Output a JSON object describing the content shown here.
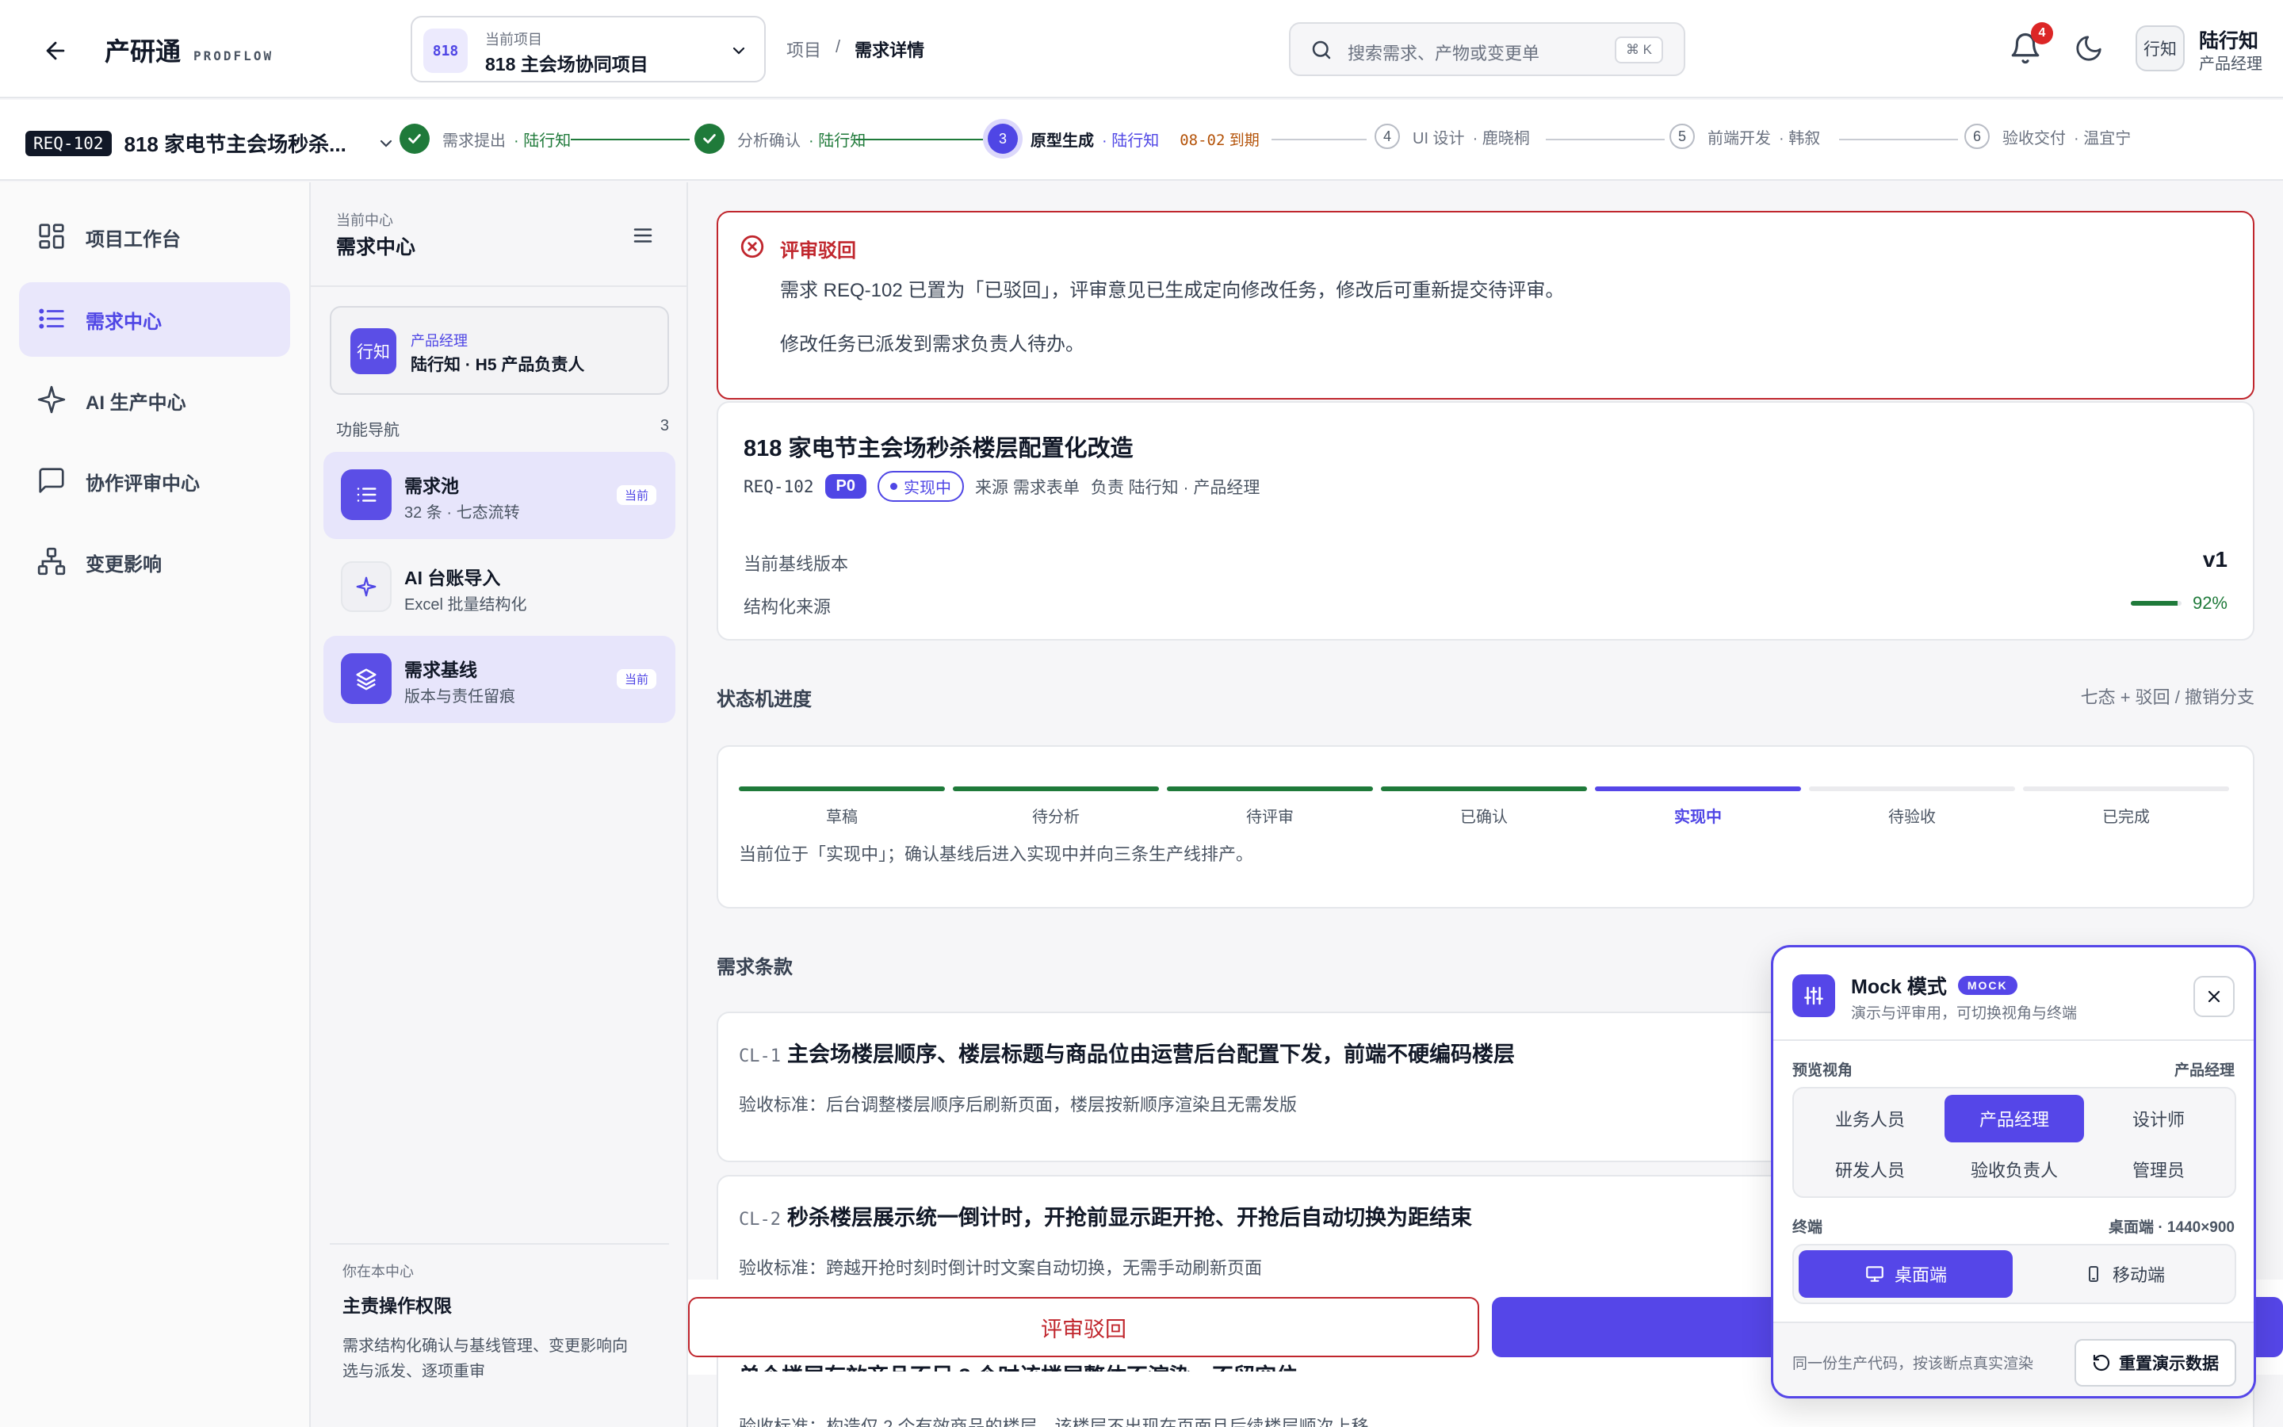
{
  "header": {
    "brand": "产研通",
    "brand_sub": "PRODFLOW",
    "project": {
      "code": "818",
      "label": "当前项目",
      "name": "818 主会场协同项目"
    },
    "breadcrumb": [
      "项目",
      "/",
      "需求详情"
    ],
    "search": {
      "placeholder": "搜索需求、产物或变更单",
      "shortcut": "⌘ K"
    },
    "notifications": "4",
    "user": {
      "avatar": "行知",
      "name": "陆行知",
      "role": "产品经理"
    }
  },
  "progress": {
    "req_code": "REQ-102",
    "req_title": "818 家电节主会场秒杀...",
    "steps": [
      {
        "num": "1",
        "label": "需求提出",
        "owner": "· 陆行知",
        "state": "done"
      },
      {
        "num": "2",
        "label": "分析确认",
        "owner": "· 陆行知",
        "state": "done"
      },
      {
        "num": "3",
        "label": "原型生成",
        "owner": "· 陆行知",
        "state": "current",
        "due_date": "08-02",
        "due_text": "到期"
      },
      {
        "num": "4",
        "label": "UI 设计",
        "owner": "· 鹿晓桐",
        "state": "pending"
      },
      {
        "num": "5",
        "label": "前端开发",
        "owner": "· 韩叙",
        "state": "pending"
      },
      {
        "num": "6",
        "label": "验收交付",
        "owner": "· 温宜宁",
        "state": "pending"
      }
    ]
  },
  "nav": {
    "items": [
      {
        "label": "项目工作台",
        "icon": "dashboard-icon"
      },
      {
        "label": "需求中心",
        "icon": "list-icon",
        "active": true
      },
      {
        "label": "AI 生产中心",
        "icon": "sparkle-icon"
      },
      {
        "label": "协作评审中心",
        "icon": "chat-icon"
      },
      {
        "label": "变更影响",
        "icon": "hierarchy-icon"
      }
    ]
  },
  "side": {
    "center_label": "当前中心",
    "center_title": "需求中心",
    "pm": {
      "avatar": "行知",
      "role": "产品经理",
      "name": "陆行知 · H5 产品负责人"
    },
    "func_label": "功能导航",
    "func_count": "3",
    "items": [
      {
        "title": "需求池",
        "sub": "32 条 · 七态流转",
        "tag": "当前"
      },
      {
        "title": "AI 台账导入",
        "sub": "Excel 批量结构化"
      },
      {
        "title": "需求基线",
        "sub": "版本与责任留痕",
        "tag": "当前"
      }
    ],
    "owner": {
      "label": "你在本中心",
      "title": "主责操作权限",
      "desc_1": "需求结构化确认与基线管理、变更影响向",
      "desc_2": "选与派发、逐项重审"
    }
  },
  "alert": {
    "title": "评审驳回",
    "line1": "需求 REQ-102 已置为「已驳回」，评审意见已生成定向修改任务，修改后可重新提交待评审。",
    "line2": "修改任务已派发到需求负责人待办。"
  },
  "card": {
    "title": "818 家电节主会场秒杀楼层配置化改造",
    "code": "REQ-102",
    "priority": "P0",
    "status": "实现中",
    "source": "来源 需求表单",
    "owner": "负责 陆行知 · 产品经理",
    "baseline_label": "当前基线版本",
    "baseline_value": "v1",
    "source_label": "结构化来源",
    "source_pct": "92%",
    "source_fraction": 0.92
  },
  "state_machine": {
    "title": "状态机进度",
    "hint": "七态 + 驳回 / 撤销分支",
    "states": [
      "草稿",
      "待分析",
      "待评审",
      "已确认",
      "实现中",
      "待验收",
      "已完成"
    ],
    "current_index": 4,
    "note": "当前位于「实现中」；确认基线后进入实现中并向三条生产线排产。"
  },
  "clauses": {
    "title": "需求条款",
    "items": [
      {
        "code": "CL-1",
        "text": "主会场楼层顺序、楼层标题与商品位由运营后台配置下发，前端不硬编码楼层",
        "accept": "验收标准：后台调整楼层顺序后刷新页面，楼层按新顺序渲染且无需发版"
      },
      {
        "code": "CL-2",
        "text": "秒杀楼层展示统一倒计时，开抢前显示距开抢、开抢后自动切换为距结束",
        "accept": "验收标准：跨越开抢时刻时倒计时文案自动切换，无需手动刷新页面"
      },
      {
        "text": "单个楼层有效商品不足 3 个时该楼层整体不渲染，不留空位",
        "accept": "验收标准：构造仅 2 个有效商品的楼层，该楼层不出现在页面且后续楼层顺次上移"
      }
    ]
  },
  "actions": {
    "reject": "评审驳回"
  },
  "mock": {
    "title": "Mock 模式",
    "badge": "MOCK",
    "subtitle": "演示与评审用，可切换视角与终端",
    "view_label": "预览视角",
    "view_current": "产品经理",
    "roles": [
      "业务人员",
      "产品经理",
      "设计师",
      "研发人员",
      "验收负责人",
      "管理员"
    ],
    "active_role": 1,
    "device_label": "终端",
    "device_current": "桌面端 · 1440×900",
    "devices": [
      "桌面端",
      "移动端"
    ],
    "footer_note": "同一份生产代码，按该断点真实渲染",
    "reset": "重置演示数据"
  },
  "colors": {
    "accent": "#5546e8",
    "success": "#1f7a3a",
    "danger": "#c0262d",
    "warning": "#b45309"
  }
}
